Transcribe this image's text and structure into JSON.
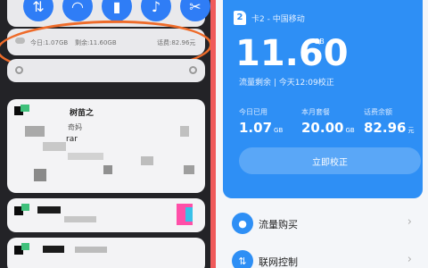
{
  "left": {
    "usage": {
      "today": "今日:1.07GB",
      "remaining": "剩余:11.60GB",
      "balance": "话费:82.96元"
    },
    "notifications": [
      {
        "title": "树苗之",
        "line1": "奇妈",
        "line2": "rar"
      }
    ]
  },
  "right": {
    "carrier": "卡2 - 中国移动",
    "sim_number": "2",
    "big_value": "11.60",
    "big_unit": "GB",
    "sub": "流量剩余 | 今天12:09校正",
    "stats": [
      {
        "label": "今日已用",
        "value": "1.07",
        "unit": "GB"
      },
      {
        "label": "本月套餐",
        "value": "20.00",
        "unit": "GB"
      },
      {
        "label": "话费余额",
        "value": "82.96",
        "unit": "元"
      }
    ],
    "calibrate_button": "立即校正",
    "menu": [
      {
        "label": "流量购买",
        "icon": "droplet-icon"
      },
      {
        "label": "联网控制",
        "icon": "updown-arrows-icon"
      }
    ]
  },
  "colors": {
    "accent": "#2e8ff5",
    "highlight_oval": "#ee6b2a",
    "divider": "#f05a5a"
  }
}
